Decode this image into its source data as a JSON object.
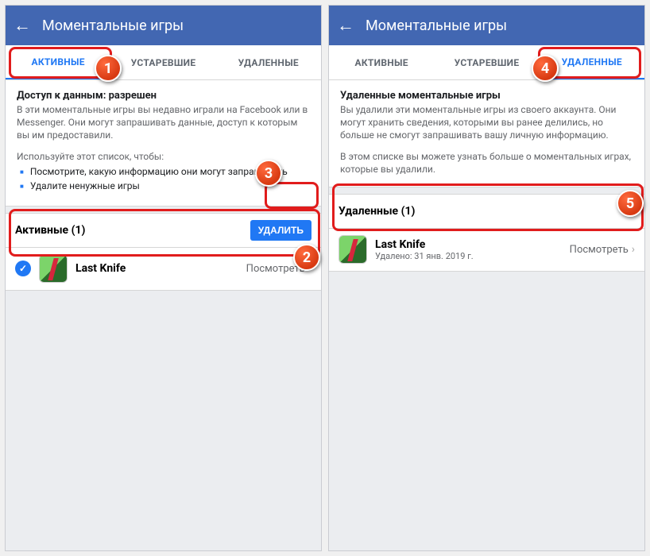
{
  "left": {
    "header": {
      "title": "Моментальные игры"
    },
    "tabs": {
      "active": "АКТИВНЫЕ",
      "obsolete": "УСТАРЕВШИЕ",
      "deleted": "УДАЛЕННЫЕ"
    },
    "info": {
      "title": "Доступ к данным: разрешен",
      "p1": "В эти моментальные игры вы недавно играли на Facebook или в Messenger. Они могут запрашивать данные, доступ к которым вы им предоставили.",
      "p2": "Используйте этот список, чтобы:",
      "b1": "Посмотрите, какую информацию они могут запрашивать",
      "b2": "Удалите ненужные игры"
    },
    "section": {
      "label": "Активные (1)",
      "button": "УДАЛИТЬ"
    },
    "row": {
      "name": "Last Knife",
      "view": "Посмотреть"
    }
  },
  "right": {
    "header": {
      "title": "Моментальные игры"
    },
    "tabs": {
      "active": "АКТИВНЫЕ",
      "obsolete": "УСТАРЕВШИЕ",
      "deleted": "УДАЛЕННЫЕ"
    },
    "info": {
      "title": "Удаленные моментальные игры",
      "p1": "Вы удалили эти моментальные игры из своего аккаунта. Они могут хранить сведения, которыми вы ранее делились, но больше не смогут запрашивать вашу личную информацию.",
      "p2": "В этом списке вы можете узнать больше о моментальных играх, которые вы удалили."
    },
    "section": {
      "label": "Удаленные (1)"
    },
    "row": {
      "name": "Last Knife",
      "sub": "Удалено: 31 янв. 2019 г.",
      "view": "Посмотреть"
    }
  },
  "badges": {
    "b1": "1",
    "b2": "2",
    "b3": "3",
    "b4": "4",
    "b5": "5"
  }
}
